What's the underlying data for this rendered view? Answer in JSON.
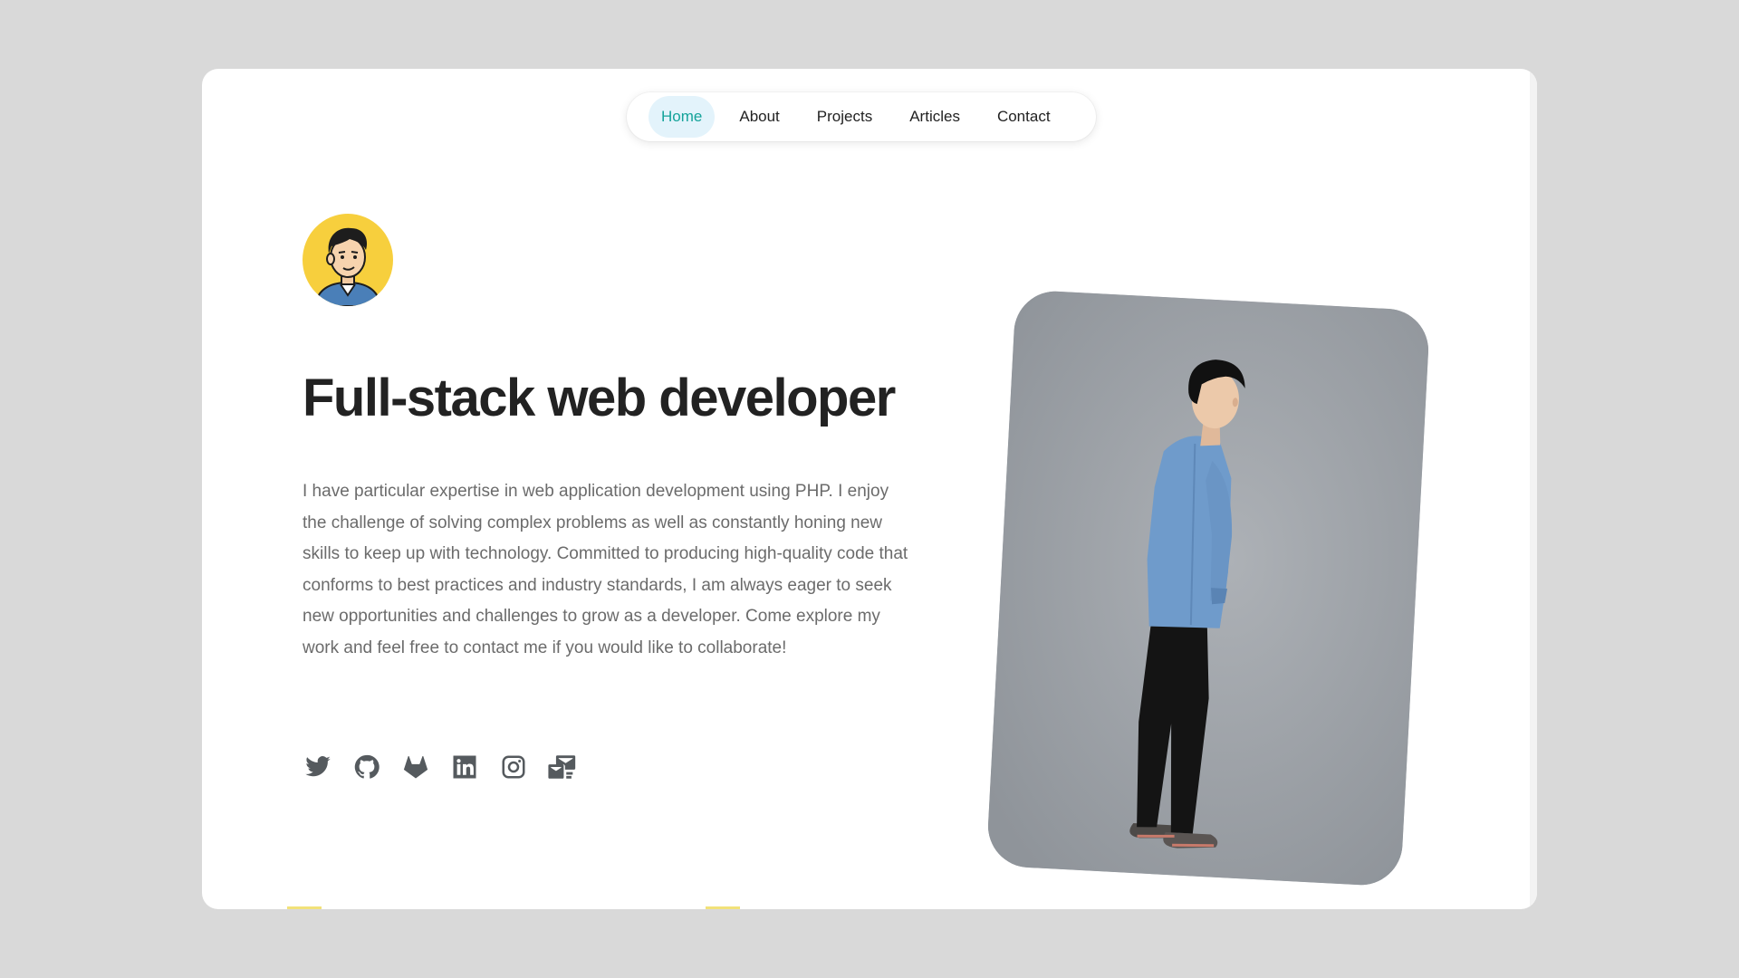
{
  "nav": {
    "items": [
      {
        "label": "Home",
        "active": true
      },
      {
        "label": "About",
        "active": false
      },
      {
        "label": "Projects",
        "active": false
      },
      {
        "label": "Articles",
        "active": false
      },
      {
        "label": "Contact",
        "active": false
      }
    ]
  },
  "hero": {
    "headline": "Full-stack web developer",
    "bio": "I have particular expertise in web application development using PHP. I enjoy the challenge of solving complex problems as well as constantly honing new skills to keep up with technology. Committed to producing high-quality code that conforms to best practices and industry standards, I am always eager to seek new opportunities and challenges to grow as a developer. Come explore my work and feel free to contact me if you would like to collaborate!"
  },
  "socials": [
    "twitter-icon",
    "github-icon",
    "gitlab-icon",
    "linkedin-icon",
    "instagram-icon",
    "mail-icon"
  ],
  "colors": {
    "accent": "#14a39a",
    "active_nav_bg": "#e3f3fb",
    "avatar_bg": "#f7cf3d",
    "page_bg": "#d9d9d9",
    "text": "#222222",
    "muted_text": "#6b6b6b"
  }
}
